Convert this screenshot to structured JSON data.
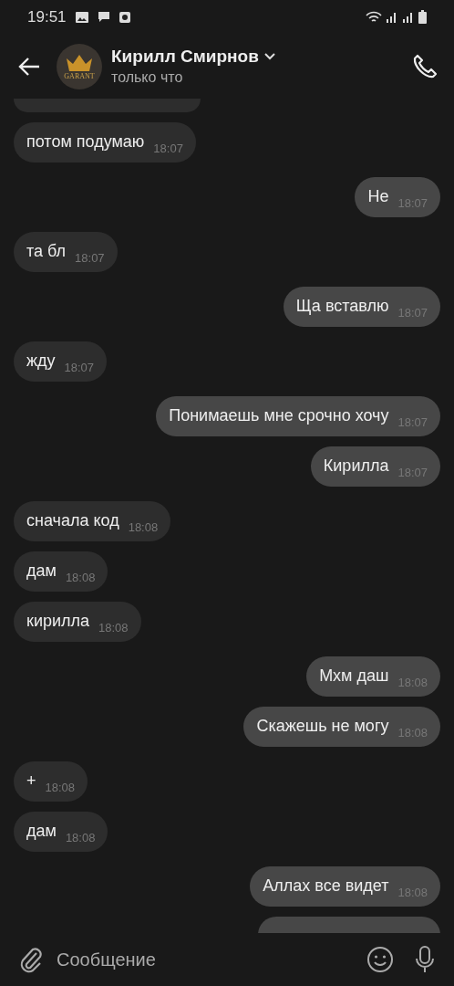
{
  "status_bar": {
    "time": "19:51"
  },
  "header": {
    "name": "Кирилл Смирнов",
    "status": "только что",
    "avatar_text": "GARANT"
  },
  "messages": [
    {
      "kind": "cut",
      "outgoing": false
    },
    {
      "kind": "message",
      "outgoing": false,
      "text": "потом подумаю",
      "time": "18:07"
    },
    {
      "kind": "message",
      "outgoing": true,
      "text": "Не",
      "time": "18:07"
    },
    {
      "kind": "message",
      "outgoing": false,
      "text": "та бл",
      "time": "18:07"
    },
    {
      "kind": "message",
      "outgoing": true,
      "text": "Ща вставлю",
      "time": "18:07"
    },
    {
      "kind": "message",
      "outgoing": false,
      "text": "жду",
      "time": "18:07"
    },
    {
      "kind": "message",
      "outgoing": true,
      "text": "Понимаешь мне срочно хочу",
      "time": "18:07"
    },
    {
      "kind": "message",
      "outgoing": true,
      "text": "Кирилла",
      "time": "18:07"
    },
    {
      "kind": "message",
      "outgoing": false,
      "text": "сначала код",
      "time": "18:08"
    },
    {
      "kind": "message",
      "outgoing": false,
      "text": "дам",
      "time": "18:08"
    },
    {
      "kind": "message",
      "outgoing": false,
      "text": "кирилла",
      "time": "18:08"
    },
    {
      "kind": "message",
      "outgoing": true,
      "text": "Мхм даш",
      "time": "18:08"
    },
    {
      "kind": "message",
      "outgoing": true,
      "text": "Скажешь не могу",
      "time": "18:08"
    },
    {
      "kind": "message",
      "outgoing": false,
      "text": "+",
      "time": "18:08"
    },
    {
      "kind": "message",
      "outgoing": false,
      "text": "дам",
      "time": "18:08"
    },
    {
      "kind": "message",
      "outgoing": true,
      "text": "Аллах все видет",
      "time": "18:08"
    },
    {
      "kind": "cut",
      "outgoing": true
    }
  ],
  "composer": {
    "placeholder": "Сообщение"
  }
}
